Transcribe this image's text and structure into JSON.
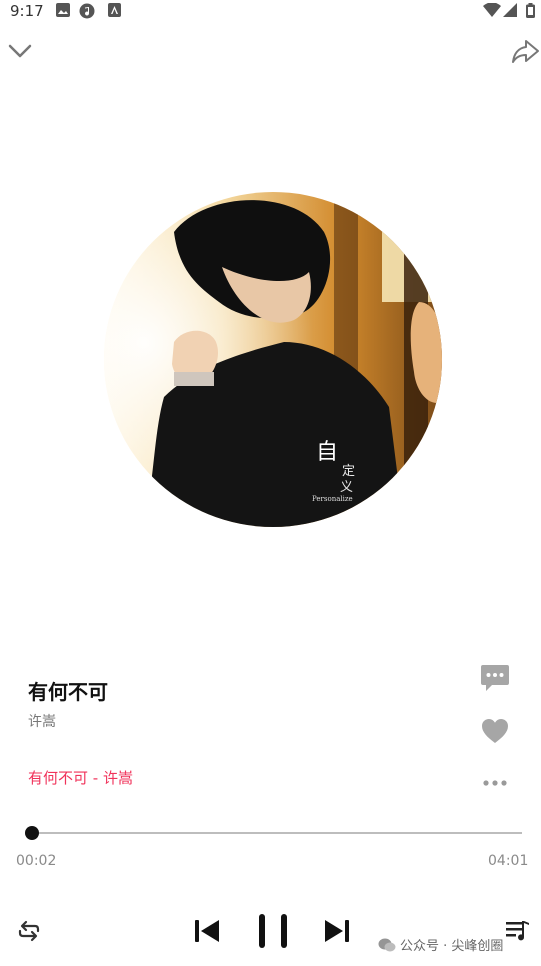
{
  "status_bar": {
    "time": "9:17",
    "left_icons": [
      "image-icon",
      "music-app-icon",
      "app-notification-icon"
    ],
    "right_icons": [
      "wifi-icon",
      "signal-icon",
      "battery-icon"
    ]
  },
  "header": {
    "collapse_icon": "chevron-down-icon",
    "share_icon": "share-icon"
  },
  "album": {
    "cover_text_main": "自",
    "cover_text_sub1": "定",
    "cover_text_sub2": "义",
    "cover_text_en": "Personalize"
  },
  "song": {
    "title": "有何不可",
    "artist": "许嵩",
    "lyric": "有何不可 - 许嵩"
  },
  "side_actions": [
    "comment-icon",
    "heart-icon",
    "more-icon"
  ],
  "playback": {
    "current_time": "00:02",
    "total_time": "04:01",
    "progress": 0.008
  },
  "controls": [
    "repeat-icon",
    "previous-icon",
    "pause-icon",
    "next-icon",
    "playlist-icon"
  ],
  "watermark": {
    "text": "公众号 · 尖峰创圈"
  },
  "colors": {
    "accent": "#f0325a",
    "icon_gray": "#a6a6a6",
    "text_secondary": "#777777"
  }
}
